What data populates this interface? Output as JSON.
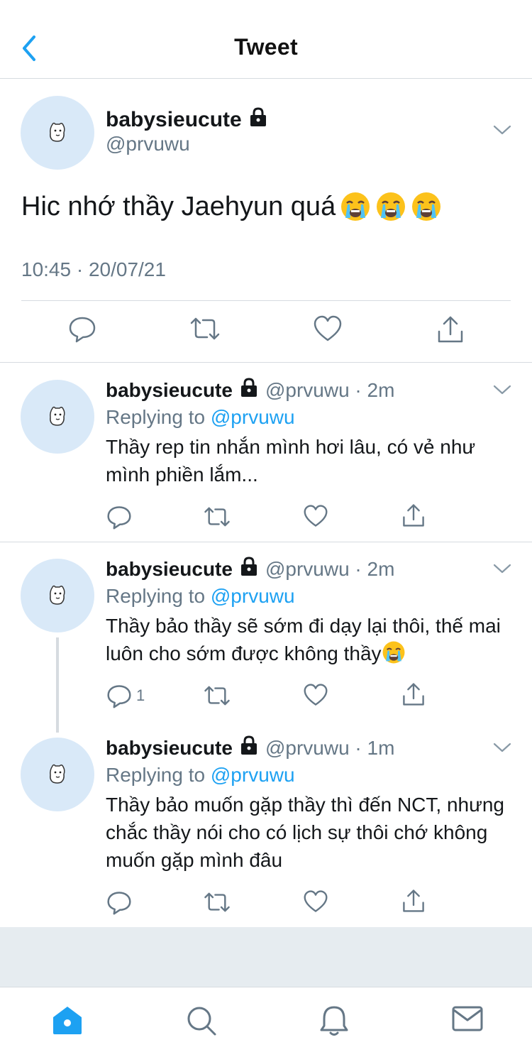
{
  "header": {
    "title": "Tweet"
  },
  "main_tweet": {
    "display_name": "babysieucute",
    "handle": "@prvuwu",
    "text": "Hic nhớ thầy Jaehyun quá",
    "emoji_count": 3,
    "timestamp": "10:45 · 20/07/21"
  },
  "replies": [
    {
      "display_name": "babysieucute",
      "meta": "@prvuwu · 2m",
      "replying_prefix": "Replying to ",
      "replying_to": "@prvuwu",
      "text": "Thầy rep tin nhắn mình hơi lâu, có vẻ như mình phiền lắm...",
      "reply_count": ""
    },
    {
      "display_name": "babysieucute",
      "meta": "@prvuwu · 2m",
      "replying_prefix": "Replying to ",
      "replying_to": "@prvuwu",
      "text": "Thầy bảo thầy sẽ sớm đi dạy lại thôi, thế mai luôn cho sớm được không thầy",
      "reply_count": "1"
    },
    {
      "display_name": "babysieucute",
      "meta": "@prvuwu · 1m",
      "replying_prefix": "Replying to ",
      "replying_to": "@prvuwu",
      "text": "Thầy bảo muốn gặp thầy thì đến NCT, nhưng chắc thầy nói cho có lịch sự thôi chớ không muốn gặp mình đâu",
      "reply_count": ""
    }
  ],
  "icons": {
    "back": "back-chevron-icon",
    "reply": "comment-icon",
    "retweet": "retweet-icon",
    "like": "heart-icon",
    "share": "share-icon",
    "lock": "lock-icon",
    "emoji": "loudly-crying-face-emoji",
    "tabs": [
      "home-icon",
      "search-icon",
      "notifications-icon",
      "messages-icon"
    ]
  },
  "colors": {
    "accent": "#1da1f2",
    "secondary_text": "#657786",
    "avatar_bg": "#d9e9f8",
    "separator": "#d6dbe0",
    "gray_band": "#e6ecf0"
  }
}
